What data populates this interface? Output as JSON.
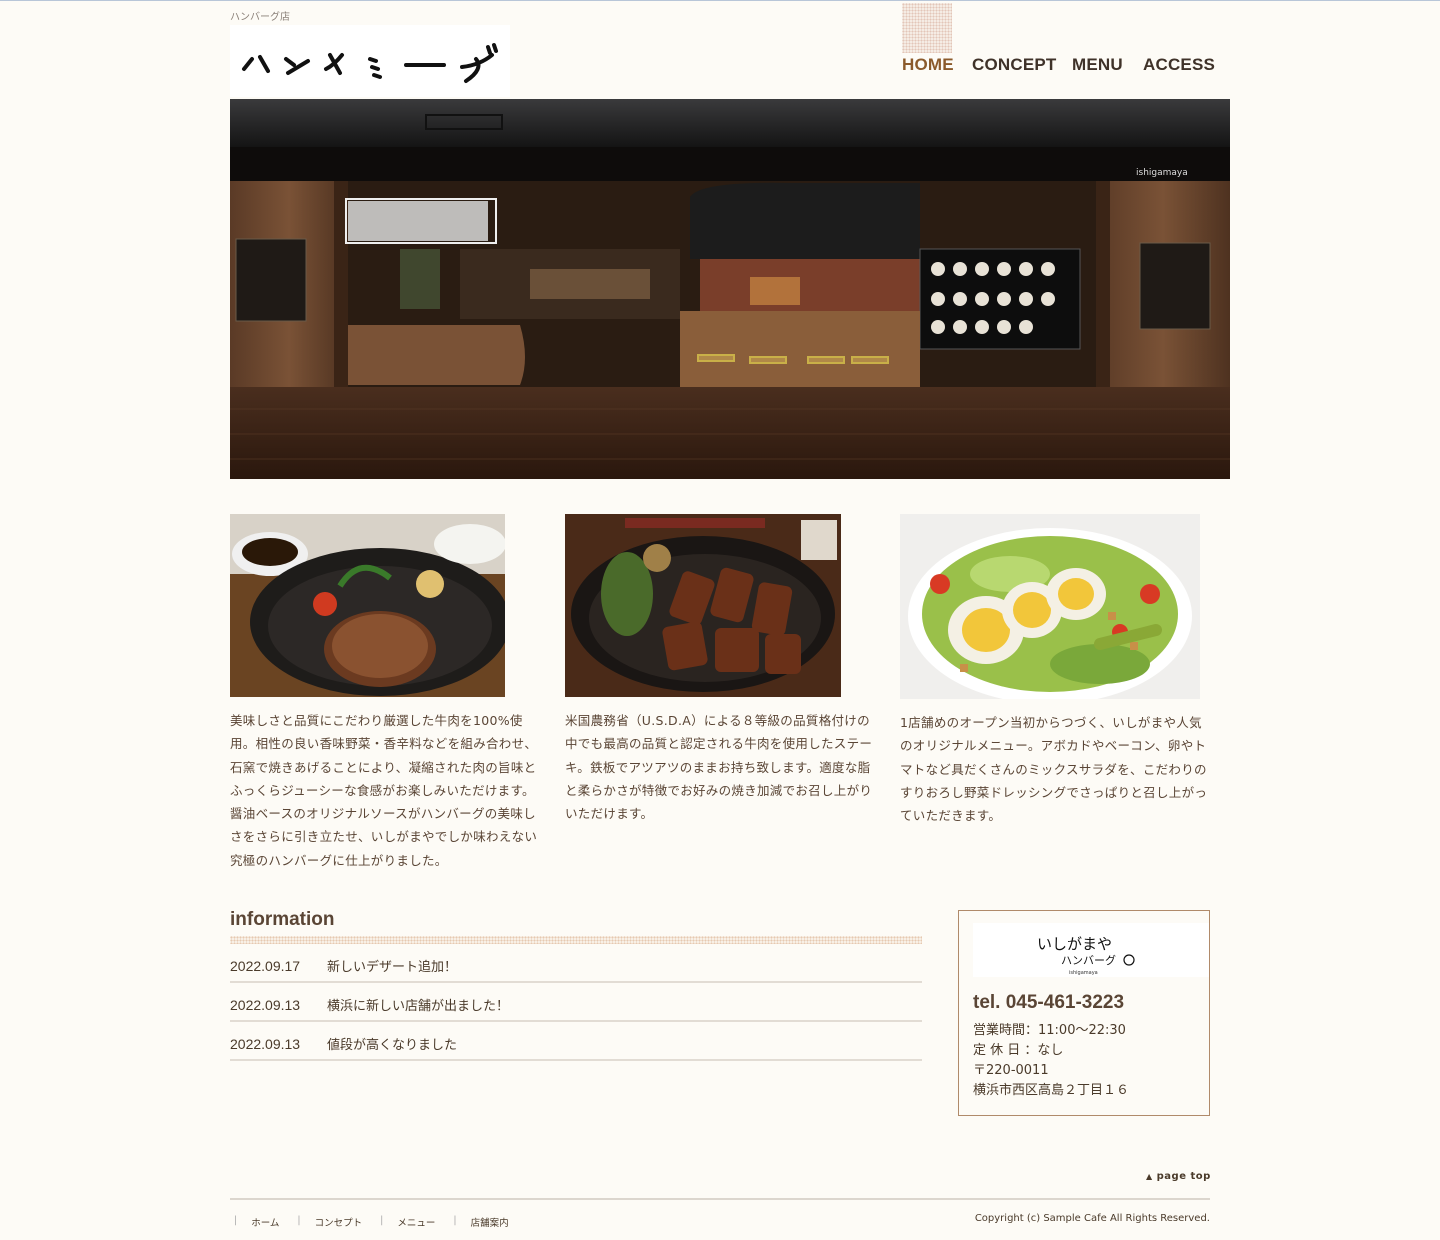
{
  "header": {
    "tagline": "ハンバーグ店",
    "logo_text": "ハンバーグ"
  },
  "nav": {
    "items": [
      {
        "label": "HOME",
        "active": true
      },
      {
        "label": "CONCEPT",
        "active": false
      },
      {
        "label": "MENU",
        "active": false
      },
      {
        "label": "ACCESS",
        "active": false
      }
    ]
  },
  "hero": {
    "sign_text": "ishigamaya"
  },
  "columns": [
    {
      "image": "hamburg-steak-photo",
      "text": "美味しさと品質にこだわり厳選した牛肉を100%使用。相性の良い香味野菜・香辛料などを組み合わせ、石窯で焼きあげることにより、凝縮された肉の旨味とふっくらジューシーな食感がお楽しみいただけます。醤油ベースのオリジナルソースがハンバーグの美味しさをさらに引き立たせ、いしがまやでしか味わえない究極のハンバーグに仕上がりました。"
    },
    {
      "image": "beef-steak-photo",
      "text": "米国農務省（U.S.D.A）による８等級の品質格付けの中でも最高の品質と認定される牛肉を使用したステーキ。鉄板でアツアツのままお持ち致します。適度な脂と柔らかさが特徴でお好みの焼き加減でお召し上がりいただけます。"
    },
    {
      "image": "salad-photo",
      "text": "1店舗めのオープン当初からつづく、いしがまや人気のオリジナルメニュー。アボカドやベーコン、卵やトマトなど具だくさんのミックスサラダを、こだわりのすりおろし野菜ドレッシングでさっぱりと召し上がっていただきます。"
    }
  ],
  "information": {
    "title": "information",
    "items": [
      {
        "date": "2022.09.17",
        "text": "新しいデザート追加！"
      },
      {
        "date": "2022.09.13",
        "text": "横浜に新しい店舗が出ました！"
      },
      {
        "date": "2022.09.13",
        "text": "値段が高くなりました"
      }
    ]
  },
  "shop": {
    "logo_line1": "いしがまや",
    "logo_line2": "ハンバーグ",
    "logo_small": "ishigamaya",
    "tel": "tel. 045-461-3223",
    "hours": "営業時間：11:00〜22:30",
    "holiday": "定 休 日 ：なし",
    "postal": "〒220-0011",
    "address": "横浜市西区高島２丁目１６"
  },
  "footer": {
    "page_top": "page top",
    "links": [
      "ホーム",
      "コンセプト",
      "メニュー",
      "店舗案内"
    ],
    "copyright": "Copyright (c) Sample Cafe All Rights Reserved."
  },
  "colors": {
    "background": "#fdfbf6",
    "nav_active": "#8b5a2b",
    "text": "#4a3a2a",
    "accent_border": "#b08a6a"
  }
}
